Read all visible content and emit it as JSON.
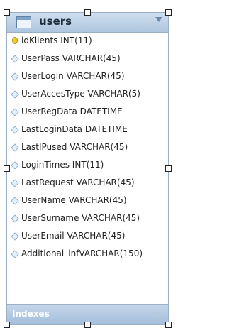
{
  "table": {
    "name": "users",
    "columns": [
      {
        "text": "idKlients INT(11)",
        "icon": "primary-key-icon"
      },
      {
        "text": "UserPass VARCHAR(45)",
        "icon": "column-icon"
      },
      {
        "text": "UserLogin VARCHAR(45)",
        "icon": "column-icon"
      },
      {
        "text": "UserAccesType VARCHAR(5)",
        "icon": "column-icon"
      },
      {
        "text": "UserRegData DATETIME",
        "icon": "column-icon"
      },
      {
        "text": "LastLoginData DATETIME",
        "icon": "column-icon"
      },
      {
        "text": "LastIPused VARCHAR(45)",
        "icon": "column-icon"
      },
      {
        "text": "LoginTimes INT(11)",
        "icon": "column-icon"
      },
      {
        "text": "LastRequest VARCHAR(45)",
        "icon": "column-icon"
      },
      {
        "text": "UserName VARCHAR(45)",
        "icon": "column-icon"
      },
      {
        "text": "UserSurname VARCHAR(45)",
        "icon": "column-icon"
      },
      {
        "text": "UserEmail VARCHAR(45)",
        "icon": "column-icon"
      },
      {
        "text": "Additional_infVARCHAR(150)",
        "icon": "column-icon"
      }
    ],
    "indexes_label": "Indexes"
  },
  "colors": {
    "header": "#aec6df",
    "border": "#9aaec4",
    "key": "#f4cc2a"
  }
}
